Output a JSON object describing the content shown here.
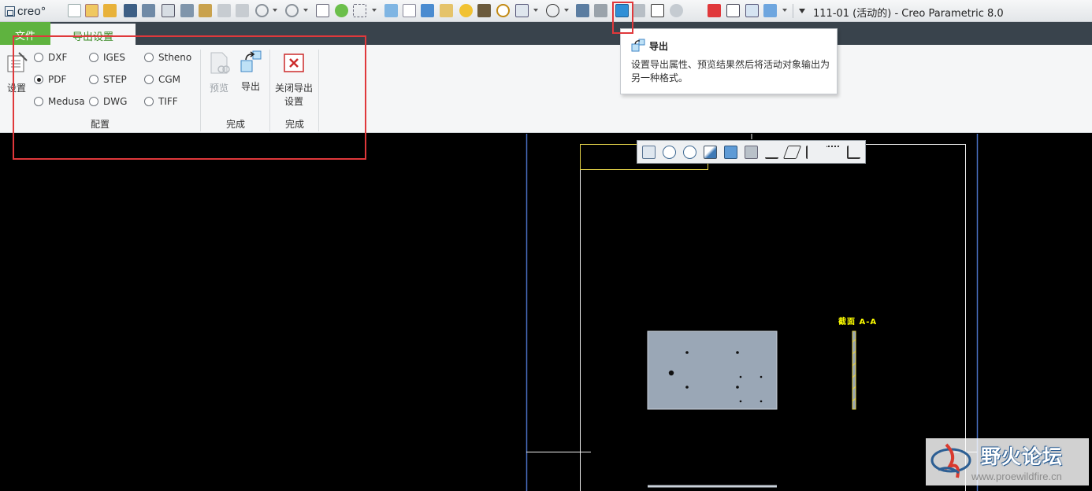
{
  "app": {
    "logo_text": "creo°",
    "window_title": "111-01 (活动的) - Creo Parametric 8.0"
  },
  "tabs": {
    "file": "文件",
    "export_settings": "导出设置"
  },
  "ribbon": {
    "settings_label": "设置",
    "formats": [
      "DXF",
      "IGES",
      "Stheno",
      "PDF",
      "STEP",
      "CGM",
      "Medusa",
      "DWG",
      "TIFF"
    ],
    "selected_format": "PDF",
    "config_group_label": "配置",
    "preview_label": "预览",
    "export_label": "导出",
    "finish_group_label": "完成",
    "close_label_line1": "关闭导出",
    "close_label_line2": "设置",
    "close_group_label": "完成"
  },
  "tooltip": {
    "title": "导出",
    "description": "设置导出属性、预览结果然后将活动对象输出为另一种格式。"
  },
  "drawing": {
    "section_label": "截面 A-A"
  },
  "watermark": {
    "name": "野火论坛",
    "url": "www.proewildfire.cn"
  },
  "colors": {
    "accent_green": "#5fb33f",
    "highlight_red": "#e0383b",
    "tabbar": "#39434c",
    "drawing_yellow": "#ffff00",
    "part_fill": "#9aa7b6"
  }
}
